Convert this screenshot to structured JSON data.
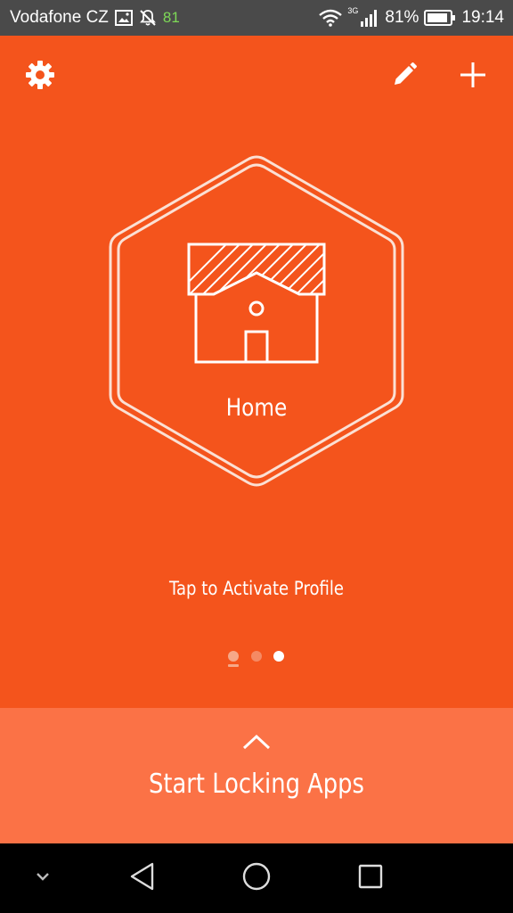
{
  "status_bar": {
    "carrier": "Vodafone CZ",
    "notification_count": "81",
    "network_type": "3G",
    "battery_percent": "81%",
    "time": "19:14",
    "icons": [
      "gallery-icon",
      "notifications-off-icon",
      "wifi-icon",
      "signal-icon",
      "battery-icon"
    ]
  },
  "toolbar": {
    "icons": [
      "gear-icon",
      "pencil-icon",
      "plus-icon"
    ]
  },
  "profile": {
    "name": "Home",
    "icon": "house-icon",
    "hint": "Tap to Activate Profile"
  },
  "pager": {
    "count": 3,
    "active_index": 2
  },
  "bottom_panel": {
    "label": "Start Locking Apps",
    "icon": "chevron-up-icon"
  },
  "nav_bar": {
    "icons": [
      "chevron-down-icon",
      "back-icon",
      "home-icon",
      "recents-icon"
    ]
  },
  "colors": {
    "background": "#f4541c",
    "panel": "#fb7246",
    "status_bar": "#4a4a4a",
    "nav_bar": "#000000",
    "accent_green": "#7ed957"
  }
}
